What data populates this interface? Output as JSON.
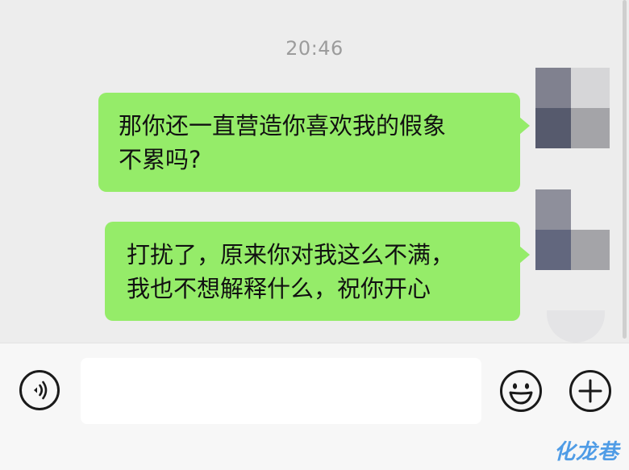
{
  "chat": {
    "timestamp": "20:46",
    "messages": [
      {
        "sender": "self",
        "text": "那你还一直营造你喜欢我的假象\n不累吗?"
      },
      {
        "sender": "self",
        "text": "打扰了，原来你对我这么不满，\n我也不想解释什么，祝你开心"
      }
    ]
  },
  "input_bar": {
    "input_value": "",
    "icons": [
      "voice-icon",
      "emoji-icon",
      "add-icon"
    ]
  },
  "watermark": {
    "text": "化龙巷"
  },
  "colors": {
    "chat_background": "#ededed",
    "bubble_self": "#95ec69",
    "input_bar": "#f7f7f7",
    "watermark": "#4f9ce6"
  }
}
